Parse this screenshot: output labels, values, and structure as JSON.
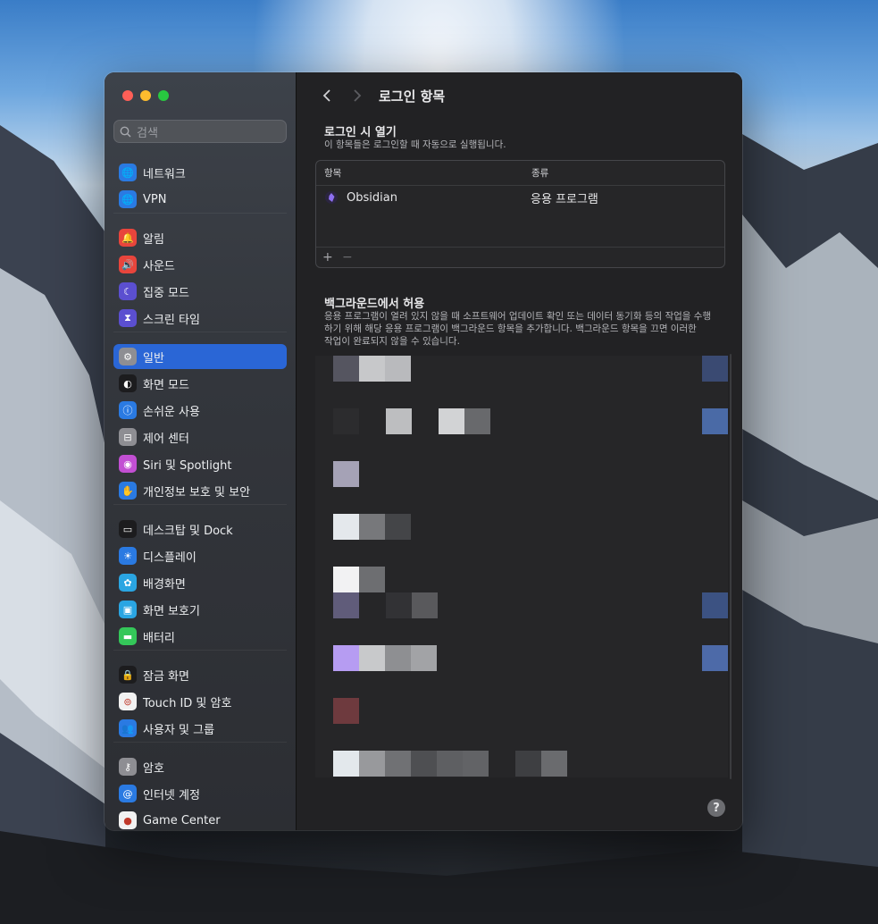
{
  "window": {
    "traffic": {
      "close": "#ff5f57",
      "minimize": "#febc2e",
      "zoom": "#28c840"
    }
  },
  "search": {
    "placeholder": "검색"
  },
  "sidebar": {
    "items": [
      {
        "label": "네트워크",
        "icon": "globe-icon",
        "color": "#2a7ae2"
      },
      {
        "label": "VPN",
        "icon": "vpn-globe-icon",
        "color": "#2a7ae2"
      },
      {
        "label": "알림",
        "icon": "bell-icon",
        "color": "#e8453c"
      },
      {
        "label": "사운드",
        "icon": "speaker-icon",
        "color": "#e8453c"
      },
      {
        "label": "집중 모드",
        "icon": "moon-icon",
        "color": "#5b4fd0"
      },
      {
        "label": "스크린 타임",
        "icon": "hourglass-icon",
        "color": "#5b4fd0"
      },
      {
        "label": "일반",
        "icon": "gear-icon",
        "color": "#8e8e93"
      },
      {
        "label": "화면 모드",
        "icon": "appearance-icon",
        "color": "#1c1c1e"
      },
      {
        "label": "손쉬운 사용",
        "icon": "accessibility-icon",
        "color": "#2a7ae2"
      },
      {
        "label": "제어 센터",
        "icon": "toggles-icon",
        "color": "#8e8e93"
      },
      {
        "label": "Siri 및 Spotlight",
        "icon": "siri-icon",
        "color": "#c24fd3"
      },
      {
        "label": "개인정보 보호 및 보안",
        "icon": "hand-icon",
        "color": "#2a7ae2"
      },
      {
        "label": "데스크탑 및 Dock",
        "icon": "dock-icon",
        "color": "#1c1c1e"
      },
      {
        "label": "디스플레이",
        "icon": "sun-icon",
        "color": "#2a7ae2"
      },
      {
        "label": "배경화면",
        "icon": "flower-icon",
        "color": "#2aa5e2"
      },
      {
        "label": "화면 보호기",
        "icon": "screensaver-icon",
        "color": "#2aa5e2"
      },
      {
        "label": "배터리",
        "icon": "battery-icon",
        "color": "#34c759"
      },
      {
        "label": "잠금 화면",
        "icon": "lock-icon",
        "color": "#1c1c1e"
      },
      {
        "label": "Touch ID 및 암호",
        "icon": "fingerprint-icon",
        "color": "#f2f2f2"
      },
      {
        "label": "사용자 및 그룹",
        "icon": "users-icon",
        "color": "#2a7ae2"
      },
      {
        "label": "암호",
        "icon": "key-icon",
        "color": "#8e8e93"
      },
      {
        "label": "인터넷 계정",
        "icon": "at-icon",
        "color": "#2a7ae2"
      },
      {
        "label": "Game Center",
        "icon": "game-center-icon",
        "color": "#f2f2f2"
      }
    ]
  },
  "main": {
    "title": "로그인 항목",
    "login": {
      "title": "로그인 시 열기",
      "desc": "이 항목들은 로그인할 때 자동으로 실행됩니다.",
      "col_item": "항목",
      "col_type": "종류",
      "rows": [
        {
          "name": "Obsidian",
          "type": "응용 프로그램"
        }
      ],
      "add": "+",
      "remove": "−"
    },
    "background": {
      "title": "백그라운드에서 허용",
      "desc_line1": "응용 프로그램이 열려 있지 않을 때 소프트웨어 업데이트 확인 또는 데이터 동기화 등의 작업을 수행",
      "desc_line2": "하기 위해 해당 응용 프로그램이 백그라운드 항목을 추가합니다. 백그라운드 항목을 끄면 이러한",
      "desc_line3": "작업이 완료되지 않을 수 있습니다."
    },
    "help": "?"
  }
}
